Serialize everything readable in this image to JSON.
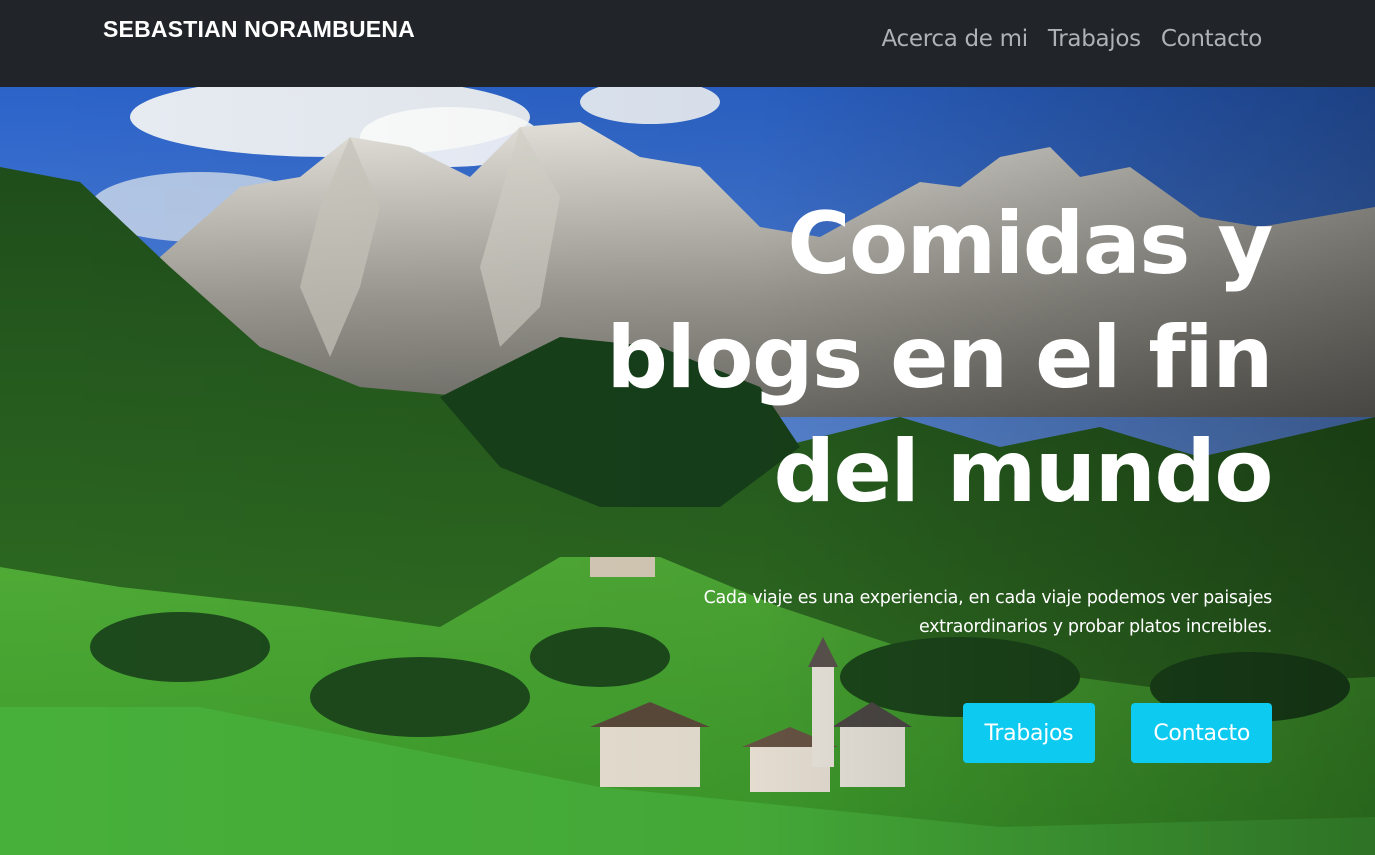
{
  "navbar": {
    "brand": "SEBASTIAN NORAMBUENA",
    "links": [
      {
        "label": "Acerca de mi"
      },
      {
        "label": "Trabajos"
      },
      {
        "label": "Contacto"
      }
    ]
  },
  "hero": {
    "title_lines": [
      "Comidas y",
      "blogs en el fin",
      "del mundo"
    ],
    "text_lines": [
      "Cada viaje es una experiencia, en cada viaje podemos ver paisajes",
      "extraordinarios y probar platos increibles."
    ],
    "buttons": [
      {
        "label": "Trabajos"
      },
      {
        "label": "Contacto"
      }
    ]
  },
  "colors": {
    "navbar_bg": "#212529",
    "nav_link": "#aeb1b5",
    "button_bg": "#0dcaf0",
    "text": "#ffffff"
  },
  "icons": {
    "background": "mountain-valley-landscape-photo"
  }
}
